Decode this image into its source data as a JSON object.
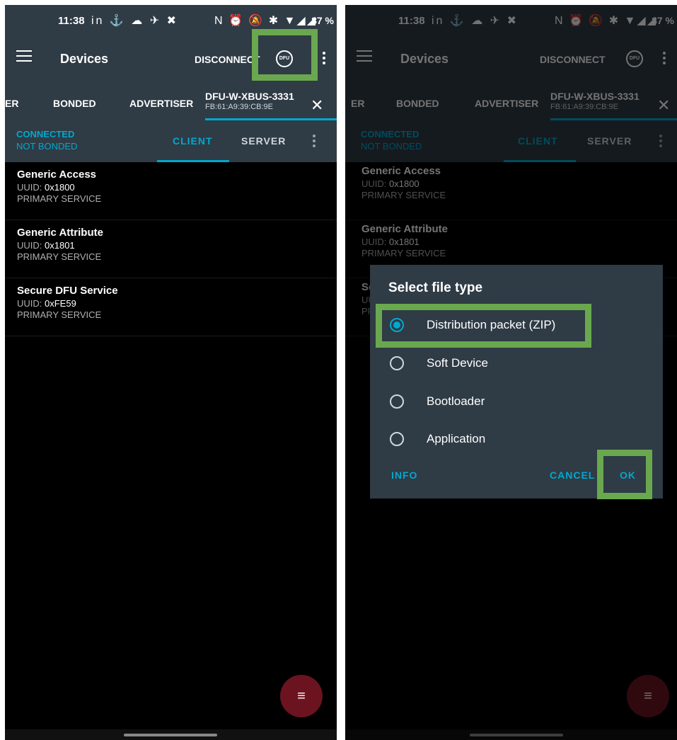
{
  "status_bar": {
    "time": "11:38",
    "battery": "87 %",
    "left_icons": "in ⚓ ☁ ✈ ✖",
    "right_icons": "N ⏰ 🔕 ✱ ▼◢◢"
  },
  "app_bar": {
    "title": "Devices",
    "disconnect_label": "DISCONNECT",
    "dfu_label": "DFU"
  },
  "tabs": {
    "cut": "ER",
    "bonded": "BONDED",
    "advertiser": "ADVERTISER",
    "device_name": "DFU-W-XBUS-3331",
    "device_address": "FB:61:A9:39:CB:9E"
  },
  "connection": {
    "status": "CONNECTED",
    "bond": "NOT BONDED",
    "client_tab": "CLIENT",
    "server_tab": "SERVER"
  },
  "services": [
    {
      "name": "Generic Access",
      "uuid_label": "UUID: ",
      "uuid": "0x1800",
      "type": "PRIMARY SERVICE"
    },
    {
      "name": "Generic Attribute",
      "uuid_label": "UUID: ",
      "uuid": "0x1801",
      "type": "PRIMARY SERVICE"
    },
    {
      "name": "Secure DFU Service",
      "uuid_label": "UUID: ",
      "uuid": "0xFE59",
      "type": "PRIMARY SERVICE"
    }
  ],
  "dialog": {
    "title": "Select file type",
    "options": [
      "Distribution packet (ZIP)",
      "Soft Device",
      "Bootloader",
      "Application"
    ],
    "selected": "Distribution packet (ZIP)",
    "info_button": "INFO",
    "cancel_button": "CANCEL",
    "ok_button": "OK"
  },
  "colors": {
    "accent": "#00a9ce",
    "bar": "#2f3b45",
    "highlight": "#6aa84f",
    "fab": "#6b1420"
  },
  "icons": {
    "menu": "menu-icon",
    "dfu": "dfu-icon",
    "more": "more-vert-icon",
    "close": "close-icon",
    "fab": "playlist-icon"
  }
}
